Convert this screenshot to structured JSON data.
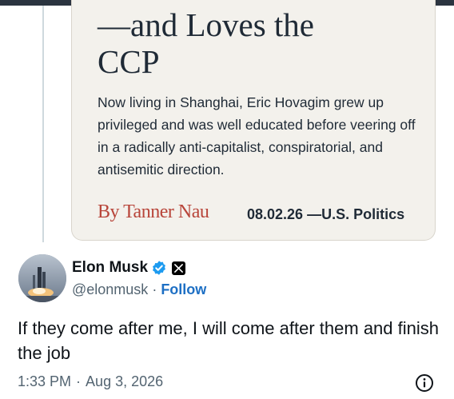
{
  "article": {
    "headline_line1": "—and Loves the",
    "headline_line2": "CCP",
    "dek": "Now living in Shanghai, Eric Hovagim grew up privileged and was well educated before veering off in a radically anti-capitalist, conspiratorial, and antisemitic direction.",
    "byline": "By Tanner Nau",
    "dateline": "08.02.26 —U.S. Politics"
  },
  "author": {
    "display_name": "Elon Musk",
    "handle": "@elonmusk",
    "separator": "·",
    "follow_label": "Follow",
    "verified_icon": "verified-badge-icon",
    "affiliation_icon": "x-logo-icon"
  },
  "tweet": {
    "text": "If they come after me, I will come after them and finish the job",
    "time": "1:33 PM",
    "separator": "·",
    "date": "Aug 3, 2026"
  },
  "colors": {
    "accent": "#1d9bf0",
    "link": "#1d6fc4",
    "byline": "#b8453a",
    "muted": "#536471"
  }
}
